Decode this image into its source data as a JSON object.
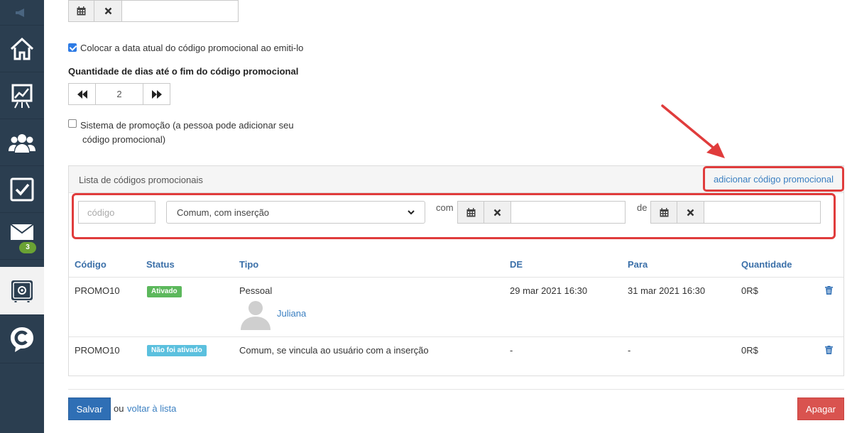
{
  "sidebar": {
    "badge_count": "3",
    "items": [
      "home-icon",
      "chart-icon",
      "users-icon",
      "tasks-icon",
      "mail-icon",
      "settings-icon",
      "brand-icon"
    ]
  },
  "form": {
    "checkbox_current_date": "Colocar a data atual do código promocional ao emiti-lo",
    "days_label": "Quantidade de dias até o fim do código promocional",
    "days_value": "2",
    "checkbox_promo_system_line1": "Sistema de promoção (a pessoa pode adicionar seu",
    "checkbox_promo_system_line2": "código promocional)"
  },
  "panel": {
    "title": "Lista de códigos promocionais",
    "add_link": "adicionar código promocional",
    "filter": {
      "code_placeholder": "código",
      "type_selected": "Comum, com inserção",
      "from_label": "com",
      "to_label": "de"
    },
    "columns": [
      "Código",
      "Status",
      "Tipo",
      "DE",
      "Para",
      "Quantidade"
    ],
    "rows": [
      {
        "code": "PROMO10",
        "status": "Ativado",
        "type": "Pessoal",
        "user": "Juliana",
        "from": "29 mar 2021 16:30",
        "to": "31 mar 2021 16:30",
        "amount": "0R$"
      },
      {
        "code": "PROMO10",
        "status": "Não foi ativado",
        "type": "Comum, se vincula ao usuário com a inserção",
        "from": "-",
        "to": "-",
        "amount": "0R$"
      }
    ]
  },
  "footer": {
    "save": "Salvar",
    "or": "ou",
    "back_link": "voltar à lista",
    "delete": "Apagar"
  },
  "colors": {
    "sidebar": "#2b3e50",
    "accent": "#3a7fc1",
    "highlight": "#e03c3c",
    "active_green": "#5cb85c",
    "inactive_blue": "#5bc0de",
    "danger": "#d9534f"
  }
}
